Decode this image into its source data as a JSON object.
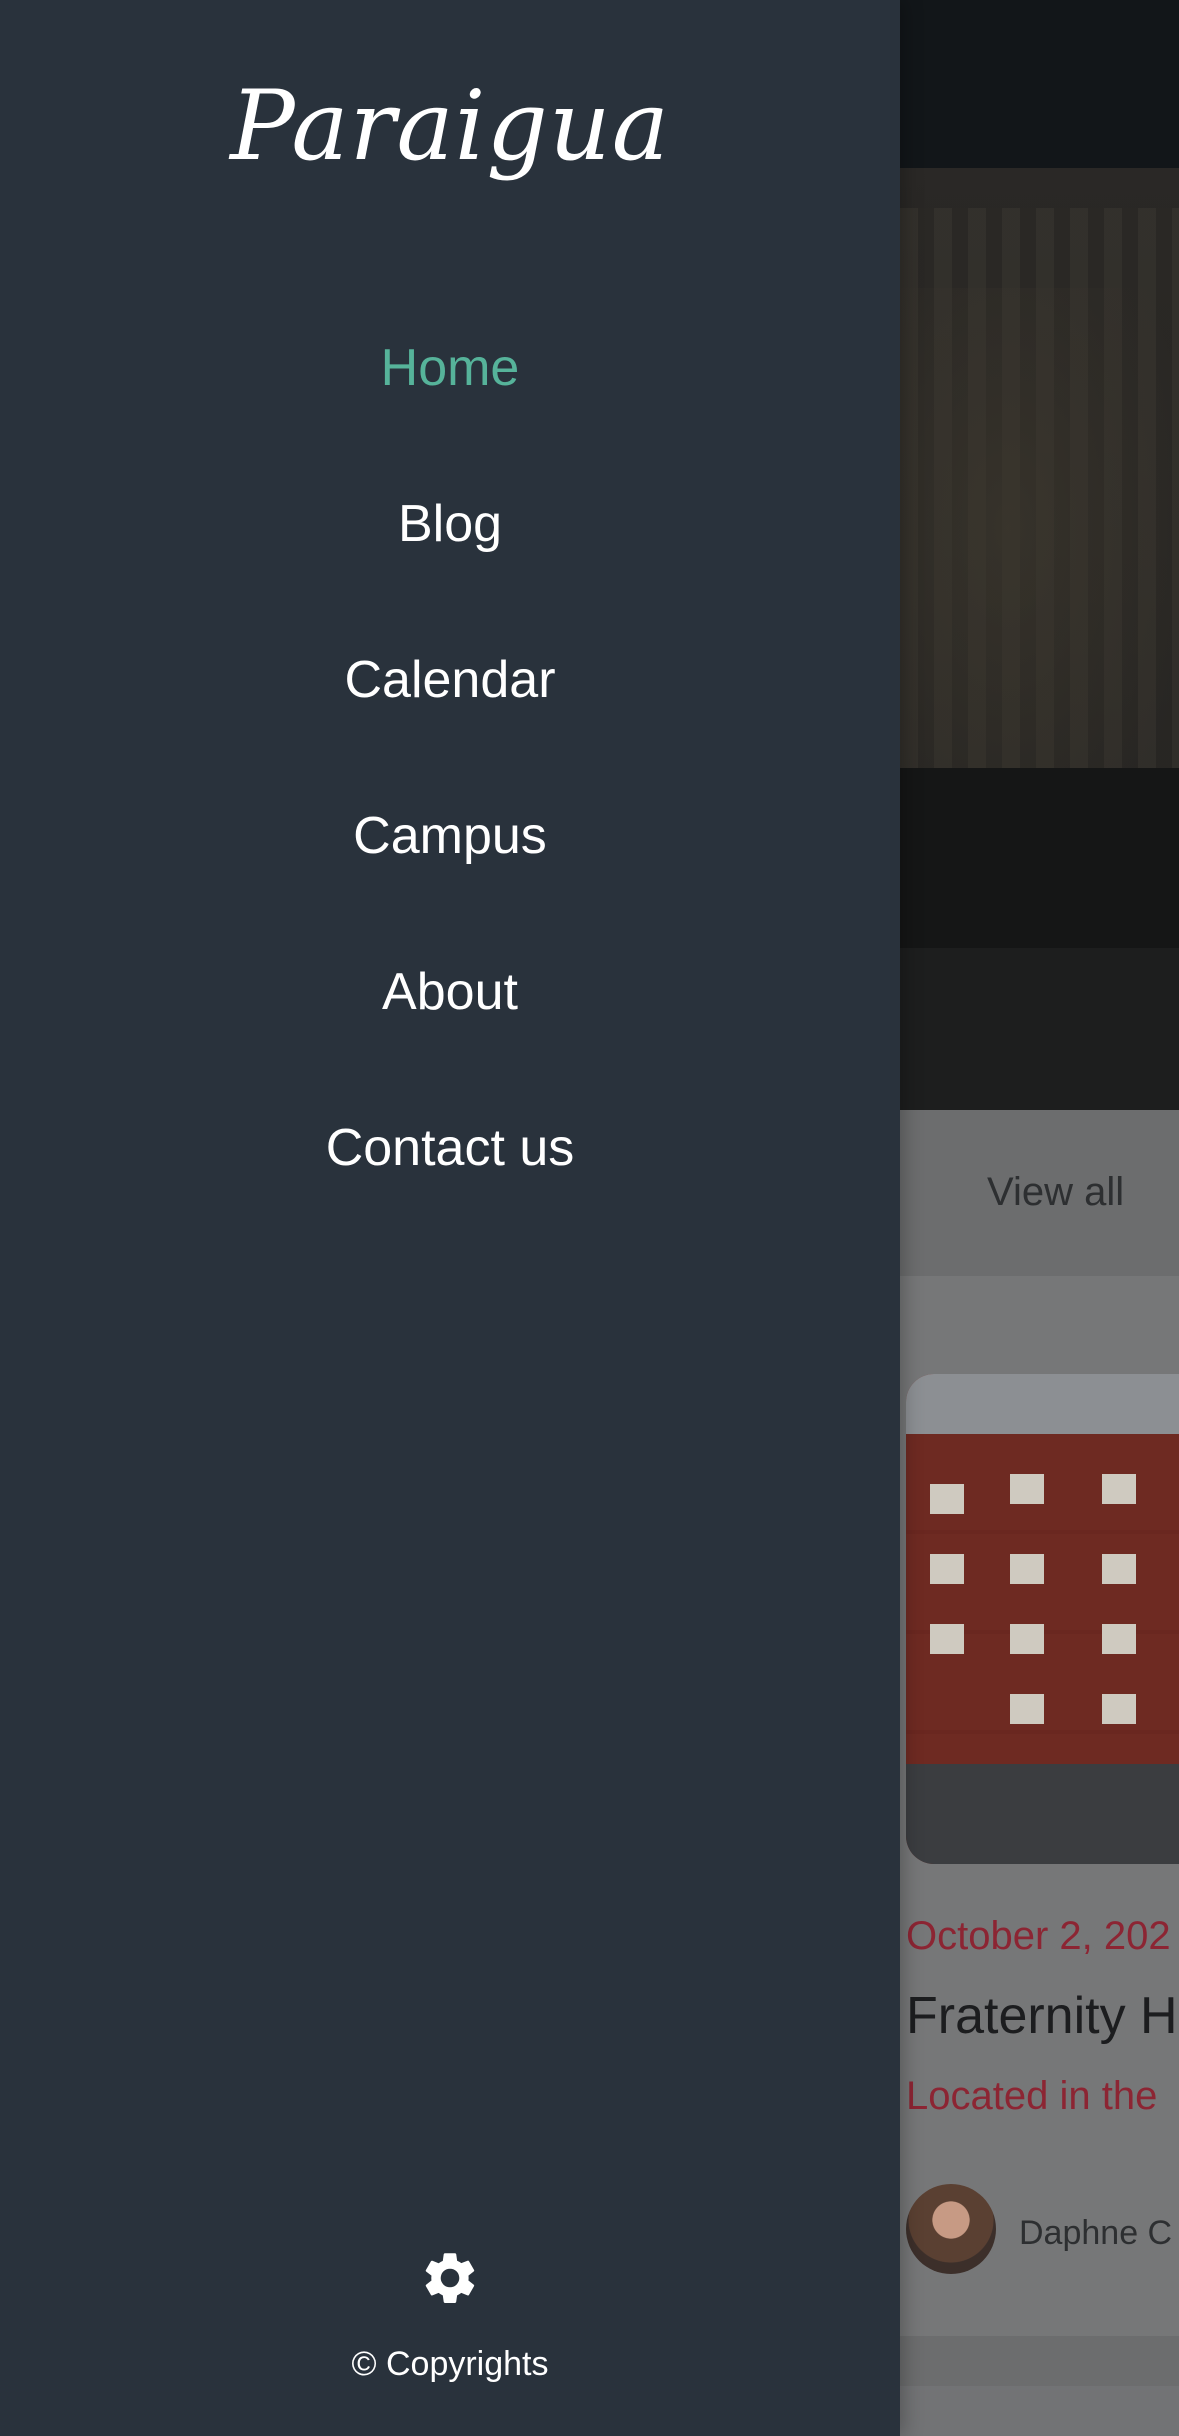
{
  "drawer": {
    "brand": "Paraigua",
    "nav": [
      {
        "label": "Home",
        "active": true
      },
      {
        "label": "Blog",
        "active": false
      },
      {
        "label": "Calendar",
        "active": false
      },
      {
        "label": "Campus",
        "active": false
      },
      {
        "label": "About",
        "active": false
      },
      {
        "label": "Contact us",
        "active": false
      }
    ],
    "settings_icon": "gear-icon",
    "copyright": "© Copyrights",
    "active_color": "#56b39a",
    "background_color": "#29323c"
  },
  "background_page": {
    "view_all_label": "View all",
    "card": {
      "date": "October 2, 202",
      "title": "Fraternity H",
      "excerpt": "Located in the",
      "author": "Daphne C"
    }
  }
}
